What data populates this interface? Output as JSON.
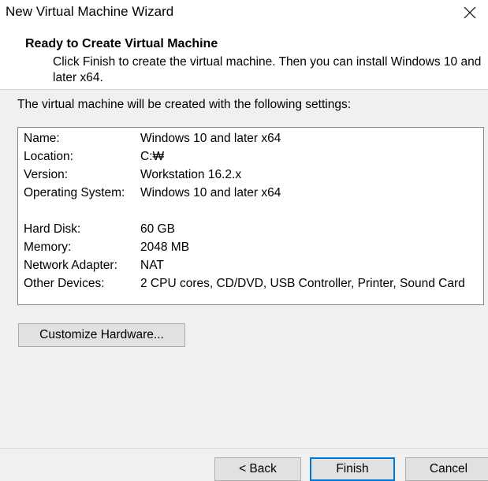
{
  "window": {
    "title": "New Virtual Machine Wizard"
  },
  "header": {
    "title": "Ready to Create Virtual Machine",
    "description": "Click Finish to create the virtual machine. Then you can install Windows 10 and later x64."
  },
  "intro_text": "The virtual machine will be created with the following settings:",
  "settings": [
    {
      "label": "Name:",
      "value": "Windows 10 and later x64"
    },
    {
      "label": "Location:",
      "value": "C:₩"
    },
    {
      "label": "Version:",
      "value": "Workstation 16.2.x"
    },
    {
      "label": "Operating System:",
      "value": "Windows 10 and later x64"
    },
    {
      "label": "Hard Disk:",
      "value": "60 GB"
    },
    {
      "label": "Memory:",
      "value": "2048 MB"
    },
    {
      "label": "Network Adapter:",
      "value": "NAT"
    },
    {
      "label": "Other Devices:",
      "value": "2 CPU cores, CD/DVD, USB Controller, Printer, Sound Card"
    }
  ],
  "buttons": {
    "customize": "Customize Hardware...",
    "back": "< Back",
    "finish": "Finish",
    "cancel": "Cancel"
  },
  "icons": {
    "close": "close-icon"
  },
  "colors": {
    "accent": "#0078d7",
    "background": "#f0f0f0"
  }
}
